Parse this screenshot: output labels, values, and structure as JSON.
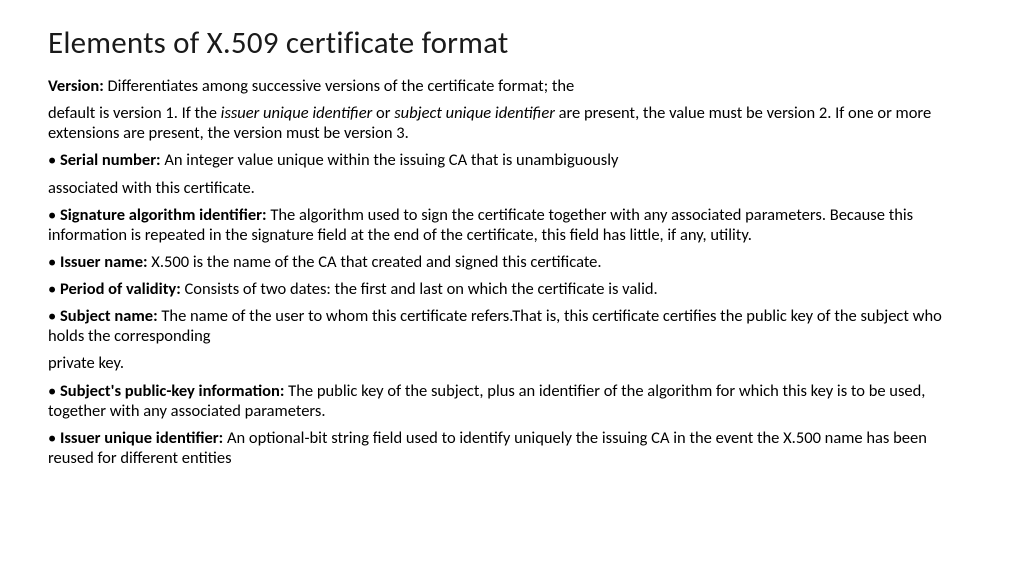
{
  "title": "Elements of X.509 certificate format",
  "p1_label": "Version:",
  "p1_text": " Differentiates among successive versions of the certificate format; the",
  "p2_a": "default is version 1. If the ",
  "p2_i1": "issuer unique identifier",
  "p2_b": " or ",
  "p2_i2": "subject unique identifier",
  "p2_c": " are present, the value must be version 2. If one or more extensions are present, the version must be version 3.",
  "p3_bullet": "• ",
  "p3_label": "Serial number:",
  "p3_text": " An integer value unique within the issuing CA that is unambiguously",
  "p4": "associated with this certificate.",
  "p5_bullet": "• ",
  "p5_label": "Signature algorithm identifier:",
  "p5_text": " The algorithm used to sign the certificate together with any associated parameters. Because this information is repeated in the signature field at the end of the certificate, this field has little, if any, utility.",
  "p6_bullet": "• ",
  "p6_label": "Issuer name:",
  "p6_text": " X.500 is the name of the CA that created and signed this certificate.",
  "p7_bullet": "• ",
  "p7_label": "Period of validity:",
  "p7_text": " Consists of two dates: the first and last on which the certificate is valid.",
  "p8_bullet": "• ",
  "p8_label": "Subject name:",
  "p8_text": " The name of the user to whom this certificate refers.That is, this certificate certifies the public key of the subject who holds the corresponding",
  "p9": "private key.",
  "p10_bullet": "• ",
  "p10_label": "Subject's public-key information:",
  "p10_text": " The public key of the subject, plus an identifier of the algorithm for which this key is to be used, together with any associated parameters.",
  "p11_bullet": "• ",
  "p11_label": "Issuer unique identifier:",
  "p11_text": " An optional-bit string field used to identify uniquely the issuing CA in the event the X.500 name has been reused for different entities"
}
